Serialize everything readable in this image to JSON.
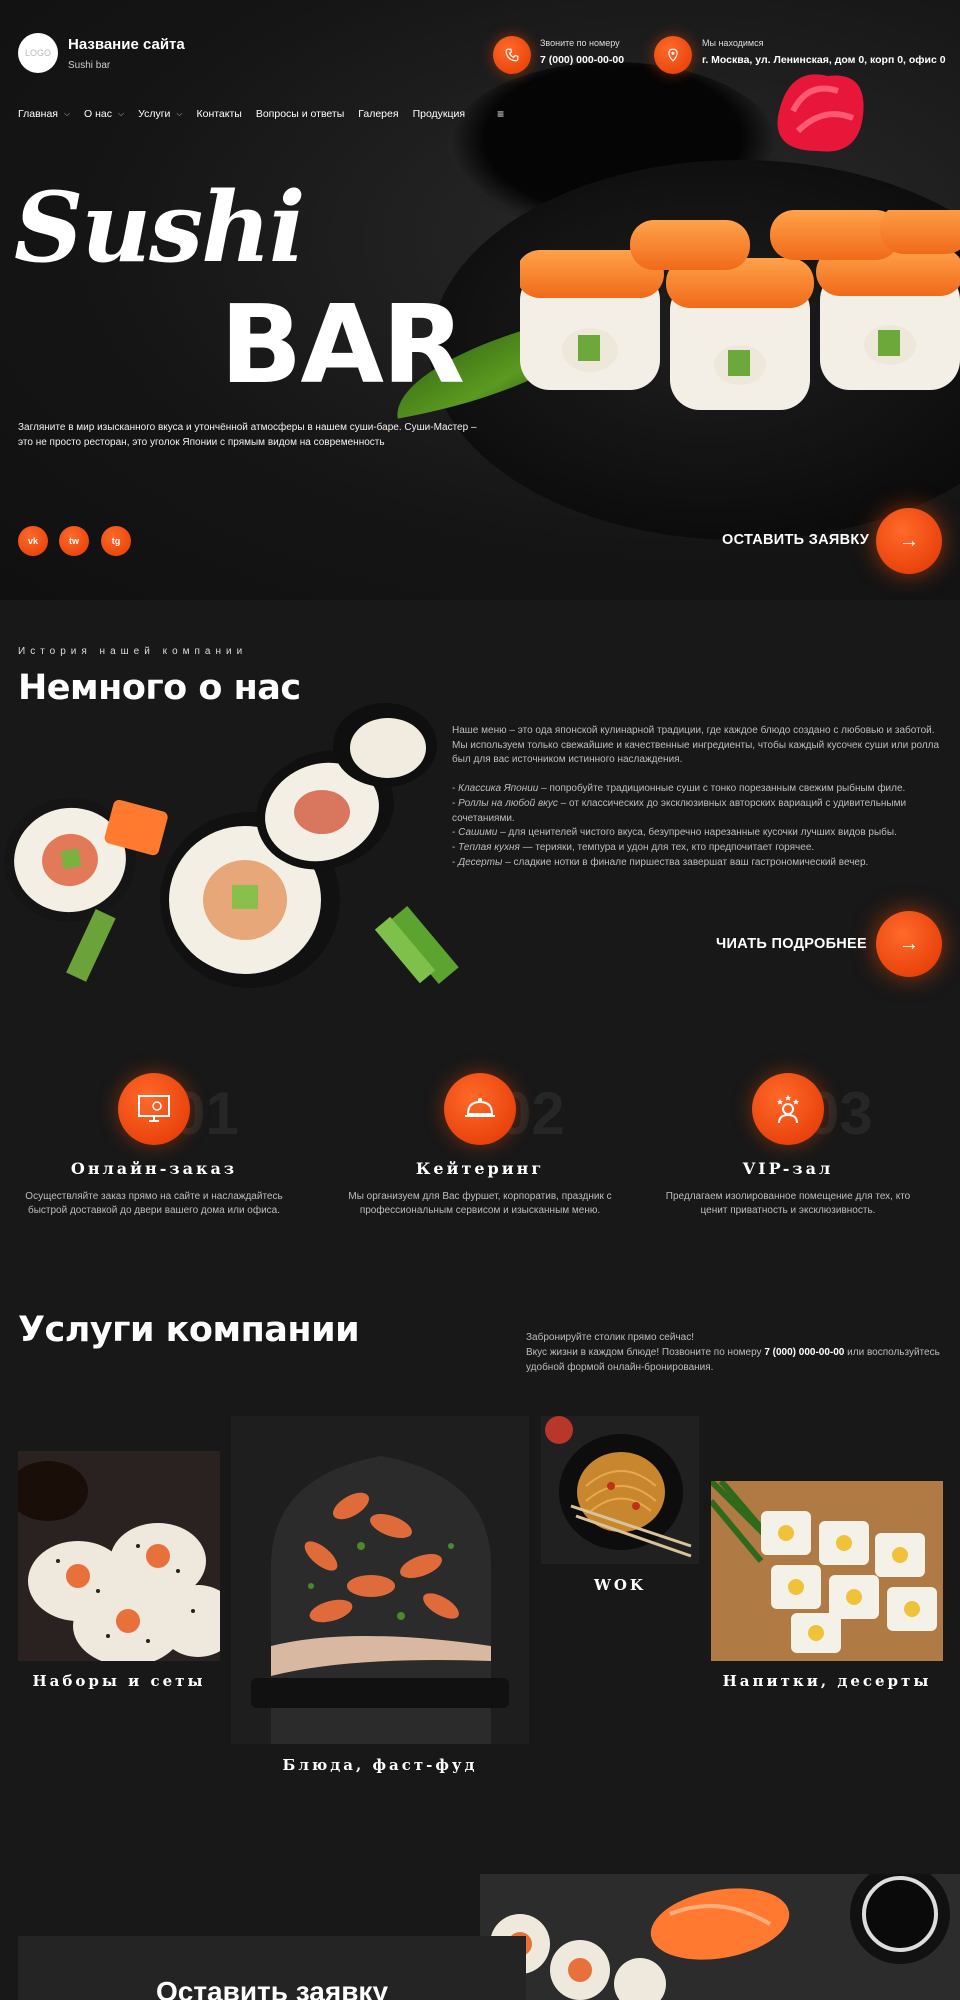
{
  "header": {
    "logo_text": "LOGO",
    "site_title": "Название сайта",
    "site_subtitle": "Sushi bar",
    "phone_label": "Звоните по номеру",
    "phone_value": "7 (000) 000-00-00",
    "address_label": "Мы находимся",
    "address_value": "г. Москва, ул. Ленинская, дом 0, корп 0, офис 0"
  },
  "nav": {
    "items": [
      "Главная",
      "О нас",
      "Услуги",
      "Контакты",
      "Вопросы и ответы",
      "Галерея",
      "Продукция"
    ],
    "menu_icon": "hamburger-icon"
  },
  "hero": {
    "title_line1": "Sushi",
    "title_line2": "BAR",
    "text": "Загляните в мир изысканного вкуса и утончённой атмосферы в нашем суши-баре. Суши-Мастер – это не просто ресторан, это уголок Японии с прямым видом на современность",
    "social": [
      "vk",
      "tw",
      "tg"
    ],
    "cta_label": "ОСТАВИТЬ ЗАЯВКУ"
  },
  "about": {
    "eyebrow": "История нашей компании",
    "title": "Немного о нас",
    "intro": "Наше меню – это ода японской кулинарной традиции, где каждое блюдо создано с любовью и заботой. Мы используем только свежайшие и качественные ингредиенты, чтобы каждый кусочек суши или ролла был для вас источником истинного наслаждения.",
    "list": [
      {
        "name": "Классика Японии",
        "text": " – попробуйте традиционные суши с тонко порезанным свежим рыбным филе."
      },
      {
        "name": "Роллы на любой вкус",
        "text": " – от классических до эксклюзивных авторских вариаций с удивительными сочетаниями."
      },
      {
        "name": "Сашими",
        "text": " – для ценителей чистого вкуса, безупречно нарезанные кусочки лучших видов рыбы."
      },
      {
        "name": "Теплая кухня",
        "text": " — терияки, темпура и удон для тех, кто предпочитает горячее."
      },
      {
        "name": "Десерты",
        "text": " – сладкие нотки в финале пиршества завершат ваш гастрономический вечер."
      }
    ],
    "more_label": "ЧИАТЬ ПОДРОБНЕЕ"
  },
  "features": [
    {
      "num": "01",
      "title": "Онлайн-заказ",
      "icon": "monitor-icon",
      "desc": "Осуществляйте заказ прямо на сайте и наслаждайтесь быстрой доставкой до двери вашего дома или офиса."
    },
    {
      "num": "02",
      "title": "Кейтеринг",
      "icon": "food-tray-icon",
      "desc": "Мы организуем для Вас фуршет, корпоратив, праздник с профессиональным сервисом и изысканным меню."
    },
    {
      "num": "03",
      "title": "VIP-зал",
      "icon": "vip-person-icon",
      "desc": "Предлагаем изолированное помещение для тех, кто ценит приватность и эксклюзивность."
    }
  ],
  "services": {
    "title": "Услуги компании",
    "book_line1": "Забронируйте столик прямо сейчас!",
    "book_line2_pre": "Вкус жизни в каждом блюде! Позвоните по номеру ",
    "book_phone": "7 (000) 000-00-00",
    "book_line2_post": " или воспользуйтесь удобной формой онлайн-бронирования.",
    "items": [
      "Наборы и сеты",
      "Блюда, фаст-фуд",
      "WOK",
      "Напитки, десерты"
    ]
  },
  "form": {
    "title": "Оставить заявку"
  },
  "colors": {
    "accent": "#ff4a0a",
    "background": "#181818"
  }
}
